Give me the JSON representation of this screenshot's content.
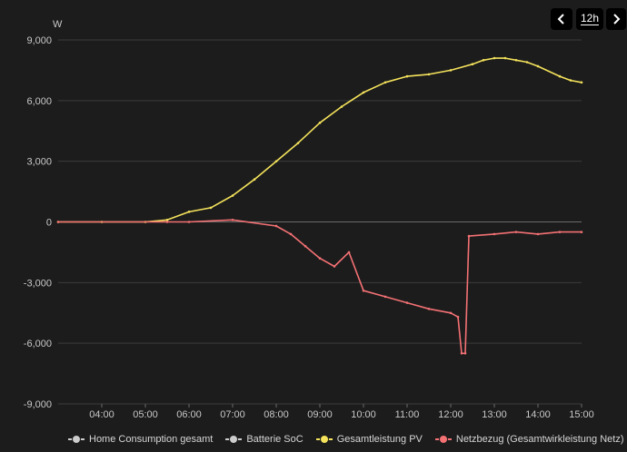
{
  "controls": {
    "prev_icon": "chevron-left-icon",
    "range_label": "12h",
    "next_icon": "chevron-right-icon"
  },
  "chart_data": {
    "type": "line",
    "unit": "W",
    "ylim": [
      -9000,
      9000
    ],
    "y_ticks": [
      9000,
      6000,
      3000,
      0,
      -3000,
      -6000,
      -9000
    ],
    "y_tick_labels": [
      "9,000",
      "6,000",
      "3,000",
      "0",
      "-3,000",
      "-6,000",
      "-9,000"
    ],
    "xlim": [
      "03:00",
      "15:00"
    ],
    "x_tick_labels": [
      "04:00",
      "05:00",
      "06:00",
      "07:00",
      "08:00",
      "09:00",
      "10:00",
      "11:00",
      "12:00",
      "13:00",
      "14:00",
      "15:00"
    ],
    "grid": true,
    "legend_position": "bottom",
    "series": [
      {
        "name": "Home Consumption gesamt",
        "color": "#cccccc",
        "x": [],
        "values": []
      },
      {
        "name": "Batterie SoC",
        "color": "#cccccc",
        "x": [],
        "values": []
      },
      {
        "name": "Gesamtleistung PV",
        "color": "#f5e35c",
        "x": [
          "03:00",
          "04:00",
          "05:00",
          "05:30",
          "06:00",
          "06:30",
          "07:00",
          "07:30",
          "08:00",
          "08:30",
          "09:00",
          "09:30",
          "10:00",
          "10:30",
          "11:00",
          "11:30",
          "12:00",
          "12:30",
          "12:45",
          "13:00",
          "13:15",
          "13:30",
          "13:45",
          "14:00",
          "14:30",
          "14:45",
          "15:00"
        ],
        "values": [
          0,
          0,
          0,
          100,
          500,
          700,
          1300,
          2100,
          3000,
          3900,
          4900,
          5700,
          6400,
          6900,
          7200,
          7300,
          7500,
          7800,
          8000,
          8100,
          8100,
          8000,
          7900,
          7700,
          7200,
          7000,
          6900
        ]
      },
      {
        "name": "Netzbezug (Gesamtwirkleistung Netz)",
        "color": "#f47174",
        "x": [
          "03:00",
          "05:30",
          "06:00",
          "07:00",
          "08:00",
          "08:20",
          "08:40",
          "09:00",
          "09:20",
          "09:40",
          "10:00",
          "10:30",
          "11:00",
          "11:30",
          "12:00",
          "12:10",
          "12:15",
          "12:20",
          "12:25",
          "13:00",
          "13:30",
          "14:00",
          "14:30",
          "15:00"
        ],
        "values": [
          0,
          0,
          0,
          100,
          -200,
          -600,
          -1200,
          -1800,
          -2200,
          -1500,
          -3400,
          -3700,
          -4000,
          -4300,
          -4500,
          -4700,
          -6500,
          -6500,
          -700,
          -600,
          -500,
          -600,
          -500,
          -500
        ]
      }
    ]
  }
}
